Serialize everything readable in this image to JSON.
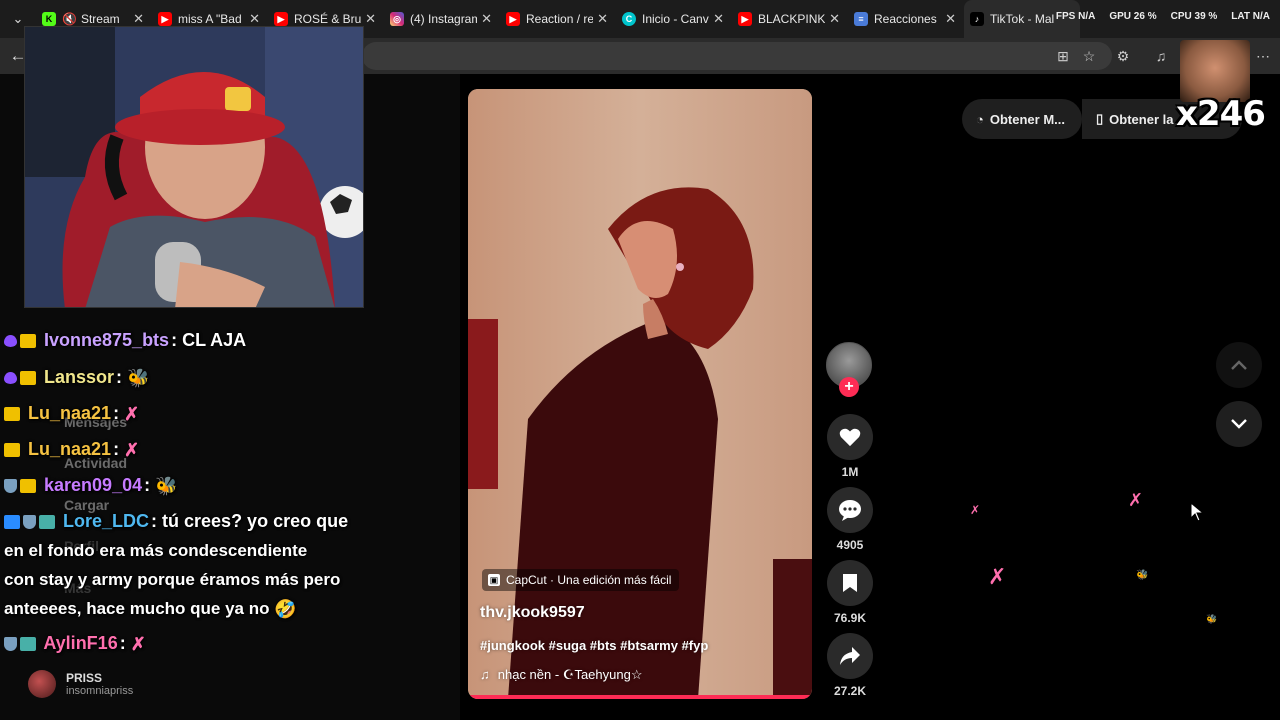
{
  "browser": {
    "tabs": [
      {
        "label": "Stream",
        "icon": "kick-icon",
        "color": "#53fc18"
      },
      {
        "label": "miss A \"Bad",
        "icon": "youtube-icon",
        "color": "#ff0000"
      },
      {
        "label": "ROSÉ & Bru",
        "icon": "youtube-icon",
        "color": "#ff0000"
      },
      {
        "label": "(4) Instagram",
        "icon": "instagram-icon",
        "color": "#d62976"
      },
      {
        "label": "Reaction / re",
        "icon": "youtube-icon",
        "color": "#ff0000"
      },
      {
        "label": "Inicio - Canv",
        "icon": "canva-icon",
        "color": "#00c4cc"
      },
      {
        "label": "BLACKPINK",
        "icon": "youtube-icon",
        "color": "#ff0000"
      },
      {
        "label": "Reacciones",
        "icon": "app-icon",
        "color": "#4a7bd8"
      },
      {
        "label": "TikTok - Mal",
        "icon": "tiktok-icon",
        "color": "#000000"
      }
    ],
    "overlay": {
      "fps": "FPS  N/A",
      "gpu": "GPU 26 %",
      "cpu": "CPU 39 %",
      "lat": "LAT  N/A"
    }
  },
  "sidebar_ghost": {
    "messages": "Mensajes",
    "activity": "Actividad",
    "upload": "Cargar",
    "profile": "Perfil",
    "more": "Más"
  },
  "chat": {
    "messages": [
      {
        "user": "Ivonne875_bts",
        "user_color": "#c9a2ff",
        "text": ": CL AJA"
      },
      {
        "user": "Lanssor",
        "user_color": "#f0e68c",
        "text": ":"
      },
      {
        "user": "Lu_naa21",
        "user_color": "#f5c242",
        "text": ":"
      },
      {
        "user": "Lu_naa21",
        "user_color": "#f5c242",
        "text": ":"
      },
      {
        "user": "karen09_04",
        "user_color": "#c67bff",
        "text": ":"
      },
      {
        "user": "Lore_LDC",
        "user_color": "#4fb8f0",
        "text": ": tú crees? yo creo que"
      },
      {
        "user": "AylinF16",
        "user_color": "#ff6fae",
        "text": ":"
      }
    ],
    "wrapped_lines": [
      "en el fondo era más condescendiente",
      "con stay y army porque éramos más pero",
      "anteeees, hace mucho que ya no"
    ]
  },
  "account": {
    "name": "PRISS",
    "handle": "insomniapriss"
  },
  "video": {
    "capcut_label": "CapCut · Una edición más fácil",
    "username": "thv.jkook9597",
    "hashtags": "#jungkook #suga #bts #btsarmy #fyp",
    "music": "nhạc nền - ☪Taehyung☆",
    "progress": 1.0
  },
  "actions": {
    "likes": "1M",
    "comments": "4905",
    "saves": "76.9K",
    "shares": "27.2K"
  },
  "top_buttons": {
    "get_app": "Obtener M...",
    "get_the": "Obtener la"
  },
  "meme_overlay": {
    "text": "x246"
  }
}
